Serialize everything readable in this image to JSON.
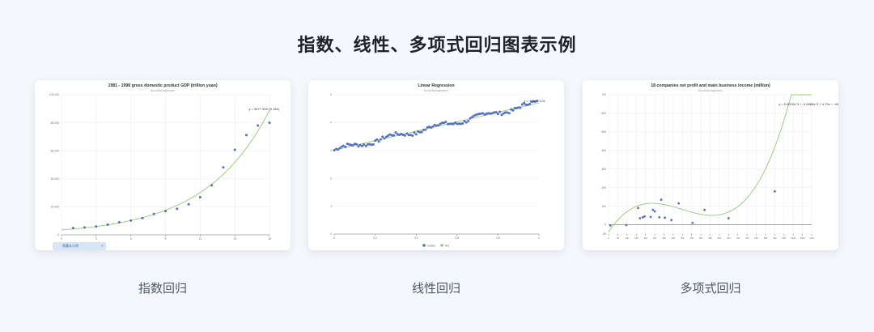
{
  "page": {
    "title": "指数、线性、多项式回归图表示例"
  },
  "captions": [
    "指数回归",
    "线性回归",
    "多项式回归"
  ],
  "corner_tag": {
    "label": "隐藏本示例",
    "close": "×"
  },
  "colors": {
    "point": "#5470c6",
    "line": "#91cc75",
    "grid": "#eceef3",
    "axis": "#6e7079"
  },
  "chart_data": [
    {
      "type": "scatter",
      "title": "1981 - 1998 gross domestic product GDP (trillion yuan)",
      "subtitle": "By ecStat.regression",
      "equation": "y = 3477.32e^(0.18x)",
      "xlim": [
        0,
        18
      ],
      "ylim": [
        0,
        100000
      ],
      "xticks": [
        0,
        3,
        6,
        9,
        12,
        15,
        18
      ],
      "yticks": [
        0,
        20000,
        40000,
        60000,
        80000,
        100000
      ],
      "ytick_labels": [
        "0",
        "20,000",
        "40,000",
        "60,000",
        "80,000",
        "100,000"
      ],
      "xtick_labels": [
        "0",
        "3",
        "6",
        "9",
        "12",
        "15",
        "18"
      ],
      "points": [
        [
          1,
          4860
        ],
        [
          2,
          5300
        ],
        [
          3,
          5960
        ],
        [
          4,
          7210
        ],
        [
          5,
          8960
        ],
        [
          6,
          10200
        ],
        [
          7,
          12000
        ],
        [
          8,
          14900
        ],
        [
          9,
          16900
        ],
        [
          10,
          18600
        ],
        [
          11,
          21800
        ],
        [
          12,
          26900
        ],
        [
          13,
          35300
        ],
        [
          14,
          48100
        ],
        [
          15,
          60700
        ],
        [
          16,
          71200
        ],
        [
          17,
          78000
        ],
        [
          18,
          80000
        ]
      ],
      "fit": {
        "a": 3477.32,
        "b": 0.18
      },
      "legend": []
    },
    {
      "type": "scatter",
      "title": "Linear Regression",
      "subtitle": "By ecStat.regression",
      "equation": "y = 1.7x + 3.01",
      "xlim": [
        0,
        1
      ],
      "ylim": [
        0,
        5
      ],
      "xticks": [
        0,
        0.2,
        0.4,
        0.6,
        0.8,
        1
      ],
      "xtick_labels": [
        "0",
        "0.2",
        "0.4",
        "0.6",
        "0.8",
        "1"
      ],
      "yticks": [
        0,
        1,
        2,
        3,
        4,
        5
      ],
      "ytick_labels": [
        "0",
        "1",
        "2",
        "3",
        "4",
        "5"
      ],
      "fit": {
        "slope": 1.7,
        "intercept": 3.01
      },
      "legend": [
        "scatter",
        "line"
      ]
    },
    {
      "type": "scatter",
      "title": "18 companies net profit and main business income (million)",
      "subtitle": "By ecStat.regression",
      "equation": "y = 0.0000x^3 + -0.0866x^2 + 4.73x + -46",
      "xlim": [
        0,
        1100
      ],
      "ylim": [
        -50,
        700
      ],
      "xticks": [
        0,
        50,
        100,
        150,
        200,
        250,
        300,
        350,
        400,
        450,
        500,
        550,
        600,
        650,
        700,
        750,
        800,
        850,
        900,
        950,
        1000,
        1050,
        1100
      ],
      "xtick_labels": [
        "0",
        "50",
        "100",
        "150",
        "200",
        "250",
        "300",
        "350",
        "400",
        "450",
        "500",
        "550",
        "600",
        "650",
        "700",
        "750",
        "800",
        "850",
        "900",
        "950",
        "1000",
        "1050",
        "1100"
      ],
      "yticks": [
        -50,
        0,
        100,
        200,
        300,
        400,
        500,
        600,
        700
      ],
      "ytick_labels": [
        "-50",
        "0",
        "100",
        "200",
        "300",
        "400",
        "500",
        "600",
        "700"
      ],
      "points": [
        [
          10,
          -4
        ],
        [
          96,
          -2
        ],
        [
          160,
          90
        ],
        [
          170,
          35
        ],
        [
          185,
          40
        ],
        [
          195,
          45
        ],
        [
          228,
          42
        ],
        [
          240,
          80
        ],
        [
          250,
          72
        ],
        [
          275,
          40
        ],
        [
          285,
          135
        ],
        [
          305,
          38
        ],
        [
          340,
          25
        ],
        [
          380,
          115
        ],
        [
          455,
          10
        ],
        [
          520,
          80
        ],
        [
          650,
          35
        ],
        [
          900,
          180
        ]
      ],
      "legend": []
    }
  ]
}
